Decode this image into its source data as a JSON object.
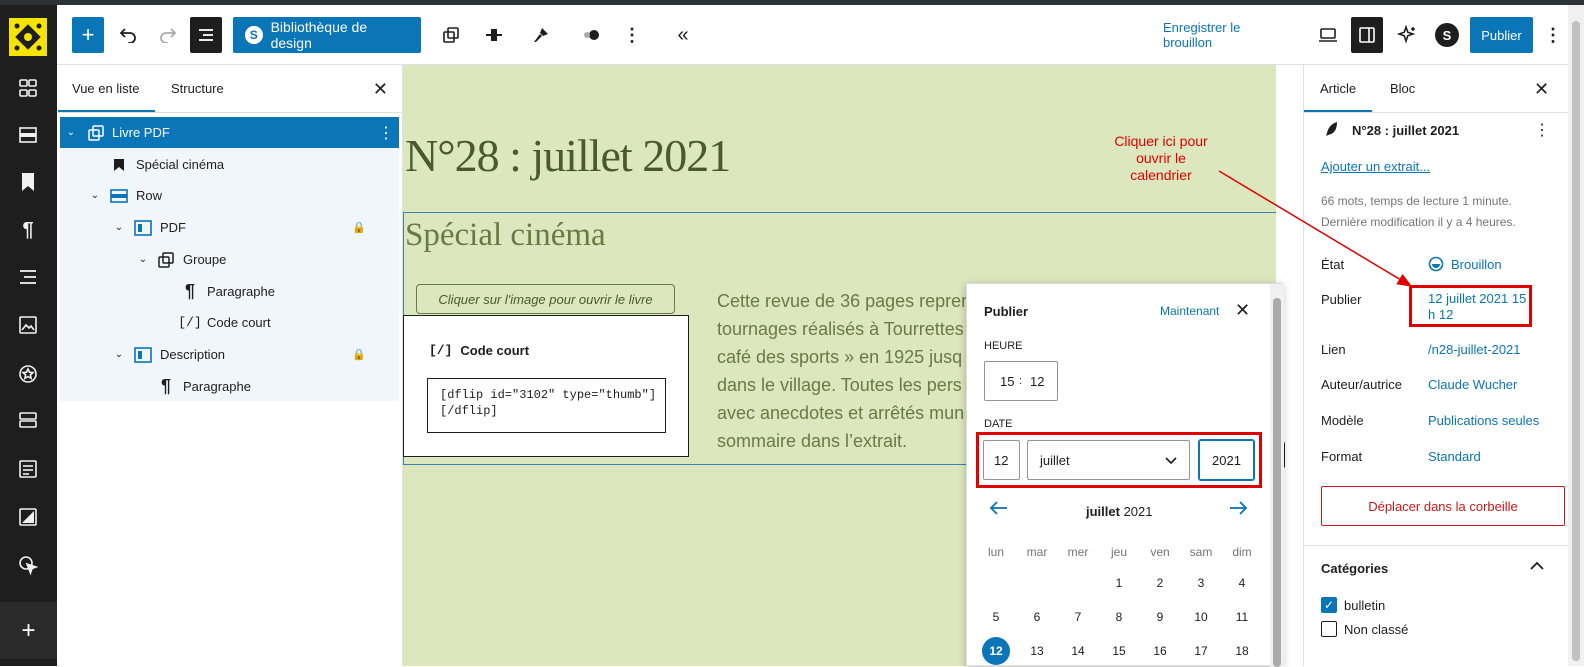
{
  "toolbar": {
    "design_library": "Bibliothèque de design",
    "save_draft": "Enregistrer le brouillon",
    "publish": "Publier"
  },
  "listview": {
    "tabs": [
      "Vue en liste",
      "Structure"
    ],
    "items": [
      {
        "label": "Livre PDF"
      },
      {
        "label": "Spécial cinéma"
      },
      {
        "label": "Row"
      },
      {
        "label": "PDF"
      },
      {
        "label": "Groupe"
      },
      {
        "label": "Paragraphe"
      },
      {
        "label": "Code court"
      },
      {
        "label": "Description"
      },
      {
        "label": "Paragraphe"
      }
    ]
  },
  "canvas": {
    "title": "N°28 : juillet 2021",
    "subtitle": "Spécial cinéma",
    "image_link": "Cliquer sur l'image pour ouvrir le livre",
    "shortcode_label": "Code court",
    "shortcode_value": "[dflip id=\"3102\" type=\"thumb\"]\n[/dflip]",
    "body_lines": [
      "Cette revue de 36 pages repren",
      "tournages réalisés à Tourrettes",
      "café des sports » en 1925 jusq",
      "dans le village. Toutes les pers",
      "avec anecdotes et arrêtés mun",
      "sommaire dans l’extrait."
    ]
  },
  "popover": {
    "title": "Publier",
    "now": "Maintenant",
    "time_label": "HEURE",
    "hour": "15",
    "minute": "12",
    "date_label": "DATE",
    "day": "12",
    "month": "juillet",
    "year": "2021",
    "calendar_month": "juillet",
    "calendar_year": "2021",
    "weekdays": [
      "lun",
      "mar",
      "mer",
      "jeu",
      "ven",
      "sam",
      "dim"
    ],
    "week1": [
      "1",
      "2",
      "3",
      "4"
    ],
    "week2": [
      "5",
      "6",
      "7",
      "8",
      "9",
      "10",
      "11"
    ],
    "week3": [
      "12",
      "13",
      "14",
      "15",
      "16",
      "17",
      "18"
    ],
    "selected_day": "12"
  },
  "sidebar": {
    "tabs": [
      "Article",
      "Bloc"
    ],
    "post_title": "N°28 : juillet 2021",
    "add_excerpt": "Ajouter un extrait...",
    "meta1": "66 mots, temps de lecture 1 minute.",
    "meta2": "Dernière modification il y a 4 heures.",
    "status_label": "État",
    "status_value": "Brouillon",
    "publish_label": "Publier",
    "publish_value_line1": "12 juillet 2021 15",
    "publish_value_line2": "h 12",
    "link_label": "Lien",
    "link_value": "/n28-juillet-2021",
    "author_label": "Auteur/autrice",
    "author_value": "Claude Wucher",
    "template_label": "Modèle",
    "template_value": "Publications seules",
    "format_label": "Format",
    "format_value": "Standard",
    "trash": "Déplacer dans la corbeille",
    "categories_title": "Catégories",
    "categories": [
      {
        "label": "bulletin",
        "checked": true
      },
      {
        "label": "Non classé",
        "checked": false
      }
    ]
  },
  "annotation": {
    "text_line1": "Cliquer ici pour",
    "text_line2": "ouvrir le",
    "text_line3": "calendrier"
  },
  "colors": {
    "accent": "#0a75b7",
    "canvas_bg": "#dce7be",
    "annotation_red": "#e00000",
    "admin_bg": "#1e1e1e"
  }
}
